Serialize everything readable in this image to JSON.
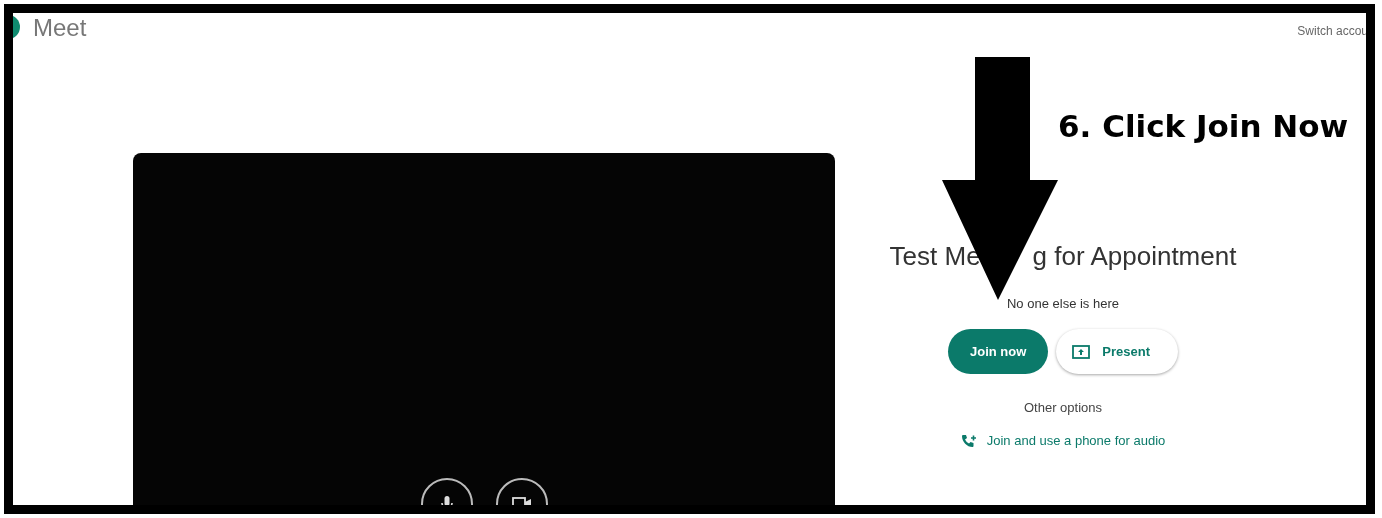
{
  "app": {
    "name": "Meet"
  },
  "account": {
    "link": "Switch accou"
  },
  "annotation": {
    "text": "6. Click Join Now"
  },
  "preview": {
    "controls": [
      {
        "kind": "mic"
      },
      {
        "kind": "camera"
      }
    ]
  },
  "meeting": {
    "title_parts": [
      "Test Me",
      "g for Appointment"
    ],
    "status": "No one else is here",
    "buttons": [
      {
        "kind": "primary",
        "label": "Join now"
      },
      {
        "kind": "present",
        "label": "Present"
      }
    ],
    "other_options": "Other options",
    "phone_link": "Join and use a phone for audio"
  }
}
